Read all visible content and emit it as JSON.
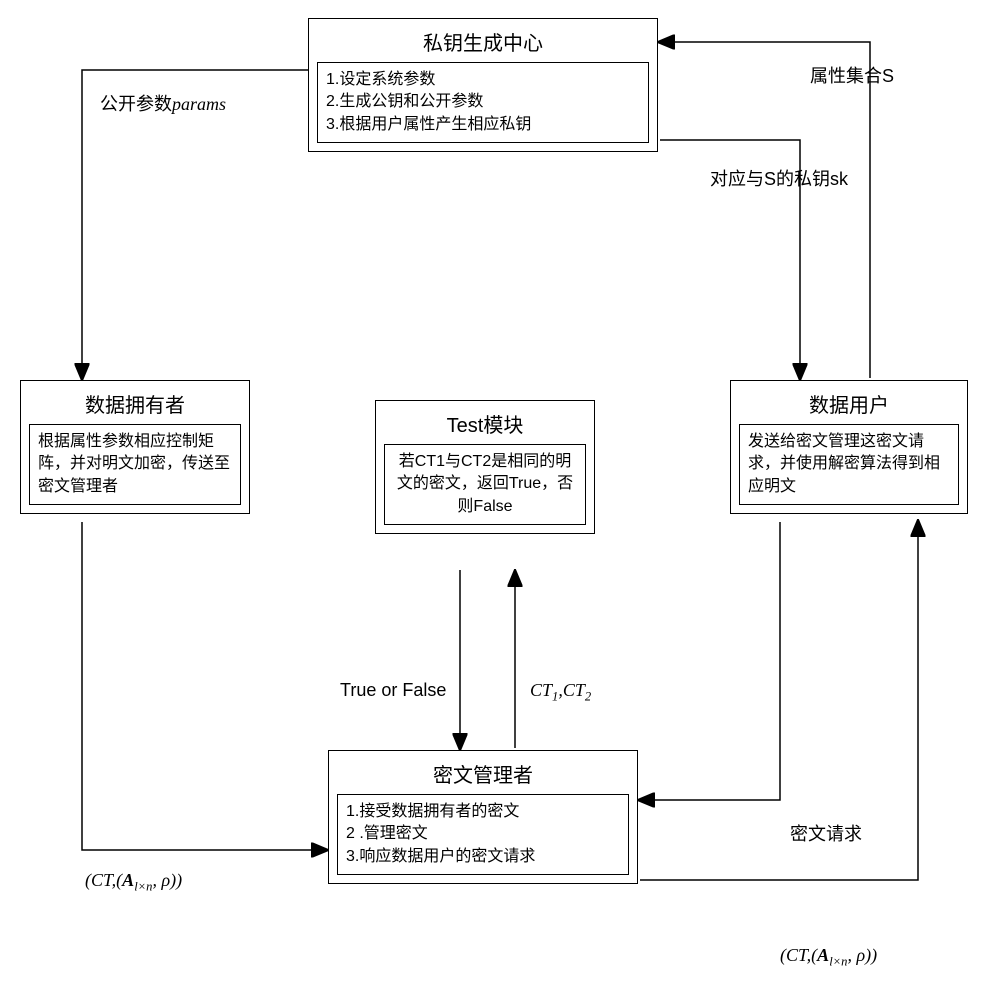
{
  "pkg_center": {
    "title": "私钥生成中心",
    "item1": "1.设定系统参数",
    "item2": "2.生成公钥和公开参数",
    "item3": "3.根据用户属性产生相应私钥"
  },
  "data_owner": {
    "title": "数据拥有者",
    "body": "根据属性参数相应控制矩阵，并对明文加密，传送至密文管理者"
  },
  "test_module": {
    "title": "Test模块",
    "body": "若CT1与CT2是相同的明文的密文，返回True，否则False"
  },
  "data_user": {
    "title": "数据用户",
    "body": "发送给密文管理这密文请求，并使用解密算法得到相应明文"
  },
  "ct_manager": {
    "title": "密文管理者",
    "item1": "1.接受数据拥有者的密文",
    "item2": "2 .管理密文",
    "item3": "3.响应数据用户的密文请求"
  },
  "labels": {
    "params": "公开参数",
    "params_italic": "params",
    "attr_set": "属性集合S",
    "sk": "对应与S的私钥sk",
    "true_false": "True or False",
    "ct12_a": "CT",
    "ct12_b": ",CT",
    "ct_a": "(CT,(",
    "ct_A": "A",
    "ct_sub": "l×n",
    "ct_c": ", ρ))",
    "ct_request": "密文请求"
  }
}
